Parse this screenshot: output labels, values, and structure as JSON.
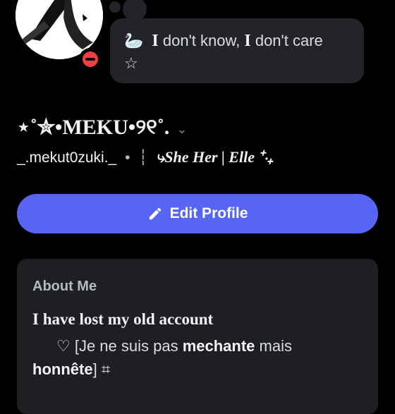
{
  "profile": {
    "status_emoji": "🦢",
    "status_first": "I",
    "status_mid": " don't know, ",
    "status_second": "I",
    "status_end": " don't care",
    "status_star": "☆",
    "display_name": "⋆˚✮•MEKU•୨୧˚.",
    "username": "_.mekut0zuki._",
    "username_dot": "•",
    "username_bar": "┆",
    "pronouns": "⤷She Her | Elle ⁺‧₊",
    "edit_button_label": "Edit Profile"
  },
  "about": {
    "title": "About Me",
    "line1": "I have lost my old account",
    "line2_prefix": "♡ [Je ne suis pas ",
    "line2_bold": "mechante",
    "line2_suffix": " mais",
    "line3_bold": "honnête",
    "line3_suffix": "] ⌗"
  },
  "colors": {
    "accent": "#5865f2",
    "dnd": "#f23f43",
    "card": "#1e1f22",
    "bubble": "#232428"
  }
}
